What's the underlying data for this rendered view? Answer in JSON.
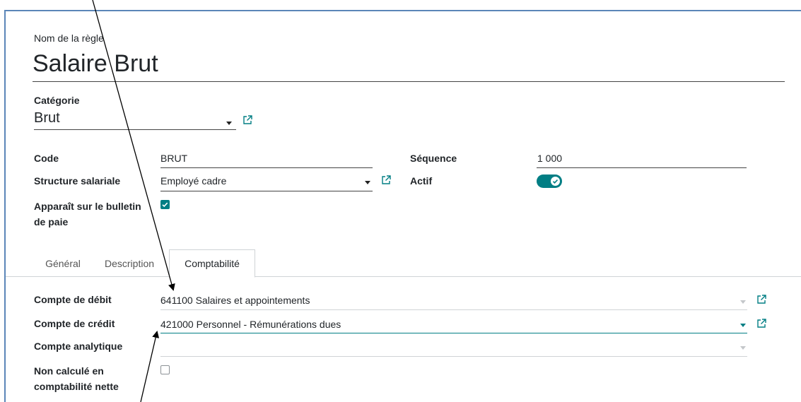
{
  "rule": {
    "name_label": "Nom de la règle",
    "name_value": "Salaire Brut"
  },
  "category": {
    "label": "Catégorie",
    "value": "Brut"
  },
  "fields": {
    "code_label": "Code",
    "code_value": "BRUT",
    "sequence_label": "Séquence",
    "sequence_value": "1 000",
    "structure_label": "Structure salariale",
    "structure_value": "Employé cadre",
    "active_label": "Actif",
    "active_on": true,
    "payslip_label_line1": "Apparaît sur le bulletin",
    "payslip_label_line2": "de paie",
    "payslip_checked": true
  },
  "tabs": [
    {
      "label": "Général",
      "active": false
    },
    {
      "label": "Description",
      "active": false
    },
    {
      "label": "Comptabilité",
      "active": true
    }
  ],
  "accounting": {
    "debit_label": "Compte de débit",
    "debit_value": "641100 Salaires et appointements",
    "credit_label": "Compte de crédit",
    "credit_value": "421000 Personnel - Rémunérations dues",
    "analytic_label": "Compte analytique",
    "analytic_value": "",
    "net_label_line1": "Non calculé en",
    "net_label_line2": "comptabilité nette",
    "net_checked": false
  },
  "colors": {
    "accent": "#017e84",
    "annotation": "#000000"
  }
}
